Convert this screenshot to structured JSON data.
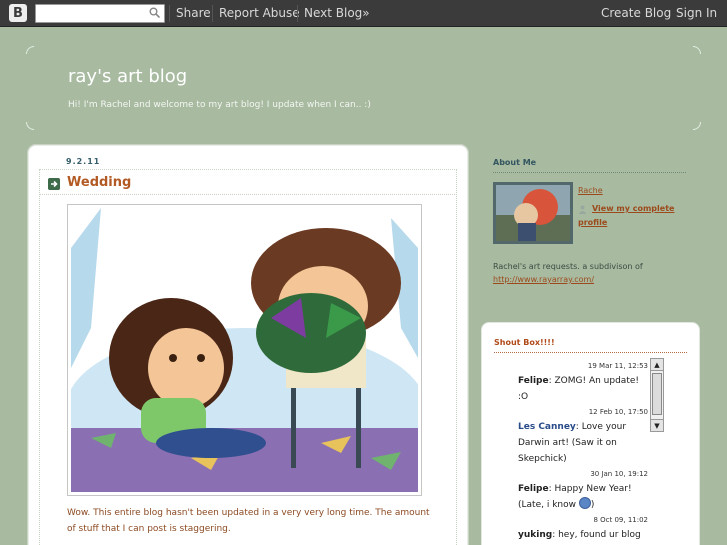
{
  "navbar": {
    "logo": "B",
    "search_placeholder": "",
    "share": "Share",
    "report_abuse": "Report Abuse",
    "next_blog": "Next Blog»",
    "create_blog": "Create Blog",
    "sign_in": "Sign In"
  },
  "header": {
    "title": "ray's art blog",
    "description": "Hi! I'm Rachel and welcome to my art blog! I update when I can.. :)"
  },
  "post": {
    "date": "9.2.11",
    "title": "Wedding",
    "body": "Wow. This entire blog hasn't been updated in a very very long time. The amount of stuff that I can post is staggering."
  },
  "about": {
    "title": "About Me",
    "name": "Rache",
    "profile_link": "View my complete profile",
    "bio": "Rachel's art requests. a subdivison of",
    "url": "http://www.rayarray.com/"
  },
  "shoutbox": {
    "title": "Shout Box!!!!",
    "entries": [
      {
        "date": "19 Mar 11, 12:53",
        "name": "Felipe",
        "message": ": ZOMG! An update! :O"
      },
      {
        "date": "12 Feb 10, 17:50",
        "name": "Les Canney",
        "message": ": Love your Darwin art! (Saw it on Skepchick)"
      },
      {
        "date": "30 Jan 10, 19:12",
        "name": "Felipe",
        "message": ": Happy New Year! (Late, i know"
      },
      {
        "date": "8 Oct 09, 11:02",
        "name": "yuking",
        "message": ": hey, found ur blog thru a search. cool"
      }
    ]
  },
  "colors": {
    "background": "#a8bba1",
    "navbar": "#3b3b3b",
    "post_title": "#b35a24",
    "link": "#9c4a1c"
  }
}
